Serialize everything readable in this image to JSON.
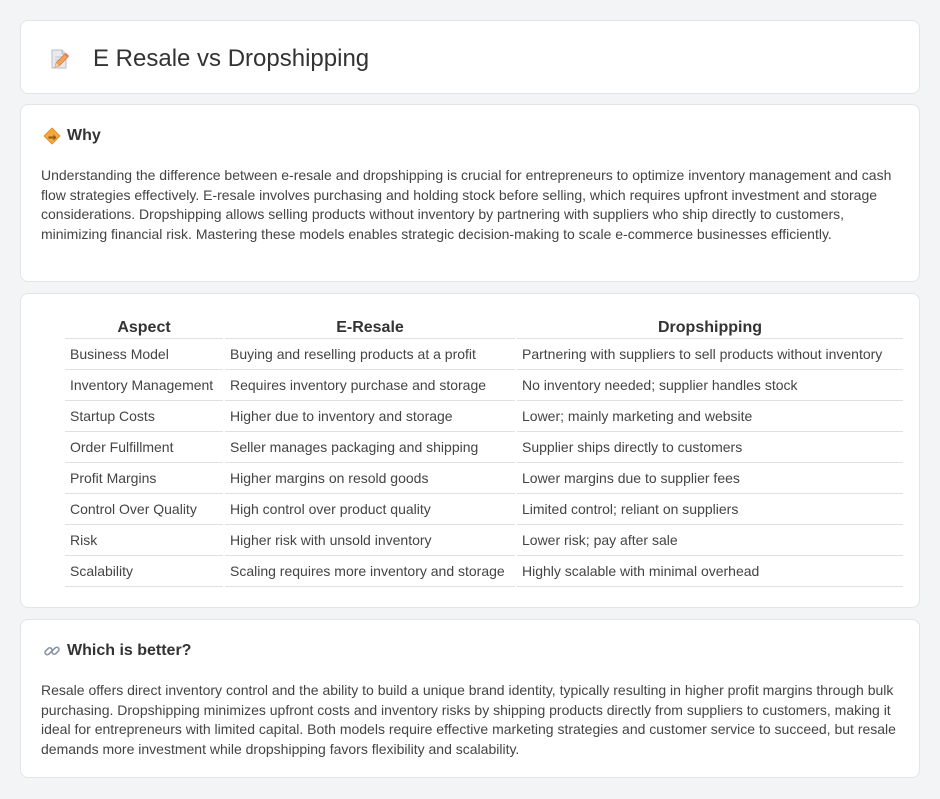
{
  "header": {
    "title": "E Resale vs Dropshipping",
    "icon": "document-pencil-icon"
  },
  "why": {
    "icon": "diamond-warning-icon",
    "title": "Why",
    "text": "Understanding the difference between e-resale and dropshipping is crucial for entrepreneurs to optimize inventory management and cash flow strategies effectively. E-resale involves purchasing and holding stock before selling, which requires upfront investment and storage considerations. Dropshipping allows selling products without inventory by partnering with suppliers who ship directly to customers, minimizing financial risk. Mastering these models enables strategic decision-making to scale e-commerce businesses efficiently."
  },
  "comparison": {
    "headers": [
      "Aspect",
      "E-Resale",
      "Dropshipping"
    ],
    "rows": [
      [
        "Business Model",
        "Buying and reselling products at a profit",
        "Partnering with suppliers to sell products without inventory"
      ],
      [
        "Inventory Management",
        "Requires inventory purchase and storage",
        "No inventory needed; supplier handles stock"
      ],
      [
        "Startup Costs",
        "Higher due to inventory and storage",
        "Lower; mainly marketing and website"
      ],
      [
        "Order Fulfillment",
        "Seller manages packaging and shipping",
        "Supplier ships directly to customers"
      ],
      [
        "Profit Margins",
        "Higher margins on resold goods",
        "Lower margins due to supplier fees"
      ],
      [
        "Control Over Quality",
        "High control over product quality",
        "Limited control; reliant on suppliers"
      ],
      [
        "Risk",
        "Higher risk with unsold inventory",
        "Lower risk; pay after sale"
      ],
      [
        "Scalability",
        "Scaling requires more inventory and storage",
        "Highly scalable with minimal overhead"
      ]
    ]
  },
  "better": {
    "icon": "link-icon",
    "title": "Which is better?",
    "text": "Resale offers direct inventory control and the ability to build a unique brand identity, typically resulting in higher profit margins through bulk purchasing. Dropshipping minimizes upfront costs and inventory risks by shipping products directly from suppliers to customers, making it ideal for entrepreneurs with limited capital. Both models require effective marketing strategies and customer service to succeed, but resale demands more investment while dropshipping favors flexibility and scalability."
  }
}
